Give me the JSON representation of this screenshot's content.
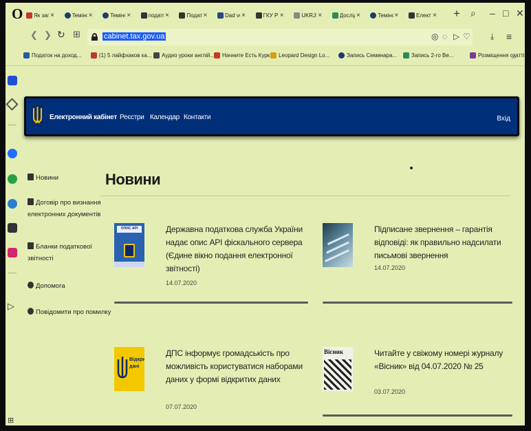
{
  "browser": {
    "logo": "O",
    "tabs": [
      {
        "label": "Як запис",
        "icon": "red-square-icon",
        "color": "#c0392b"
      },
      {
        "label": "Teмінол",
        "icon": "question-circle-icon",
        "color": "#1f3b6b"
      },
      {
        "label": "Teмінол",
        "icon": "question-circle-icon",
        "color": "#1f3b6b"
      },
      {
        "label": "податк",
        "icon": "google-icon",
        "color": "#333333"
      },
      {
        "label": "Подат",
        "icon": "ukraine-trident-icon",
        "color": "#333333"
      },
      {
        "label": "Dad ve",
        "icon": "book-icon",
        "color": "#2a4a7a"
      },
      {
        "label": "ГКУ Р",
        "icon": "ukraine-trident-icon",
        "color": "#333333"
      },
      {
        "label": "UKRJNE",
        "icon": "dash-icon",
        "color": "#888888"
      },
      {
        "label": "Досліді",
        "icon": "drive-icon",
        "color": "#2e8b57"
      },
      {
        "label": "Teмінол",
        "icon": "question-circle-icon",
        "color": "#1f3b6b"
      },
      {
        "label": "Електрс",
        "icon": "document-icon",
        "color": "#333333"
      }
    ],
    "url": "cabinet.tax.gov.ua",
    "bookmarks": [
      {
        "label": "Податок на доход...",
        "icon": "tax-doc-icon",
        "color": "#2a5a9a"
      },
      {
        "label": "(1) 5 лайфхаков ка...",
        "icon": "youtube-icon",
        "color": "#c0392b"
      },
      {
        "label": "Аудио уроки англій...",
        "icon": "audio-icon",
        "color": "#444444"
      },
      {
        "label": "Начните Есть Курк...",
        "icon": "youtube-icon",
        "color": "#c0392b"
      },
      {
        "label": "Leopard Design Lo...",
        "icon": "leopard-icon",
        "color": "#d4a017"
      },
      {
        "label": "Запись Семинара...",
        "icon": "circle-icon",
        "color": "#1f3b6b"
      },
      {
        "label": "Запись 2-го Ве...",
        "icon": "drive-icon",
        "color": "#2e8b57"
      },
      {
        "label": "Розміщення статті...",
        "icon": "pen-icon",
        "color": "#7a3b9a"
      }
    ]
  },
  "site": {
    "nav": [
      "Електронний кабінет",
      "Реєстри",
      "Календар",
      "Контакти"
    ],
    "login": "Вхід",
    "sidebar": [
      {
        "label": "Новини",
        "icon": "newspaper-icon"
      },
      {
        "label": "Договір про визнання електронних документів",
        "icon": "contract-icon"
      },
      {
        "label": "Бланки податкової звітності",
        "icon": "forms-icon"
      },
      {
        "label": "Допомога",
        "icon": "help-icon"
      },
      {
        "label": "Повідомити про помилку",
        "icon": "report-icon"
      }
    ],
    "page_title": "Новини",
    "news": [
      {
        "headline": "Державна податкова служба України надає опис API фіскального сервера (Єдине вікно подання електронної звітності)",
        "date": "14.07.2020",
        "thumb_text": "ОПИС API"
      },
      {
        "headline": "Підписане звернення – гарантія відповіді: як правильно надсилати письмові звернення",
        "date": "14.07.2020",
        "thumb_text": ""
      },
      {
        "headline": "ДПС інформує громадськість про можливість користуватися наборами даних у формі відкритих даних",
        "date": "07.07.2020",
        "thumb_text": "Відкриті дані"
      },
      {
        "headline": "Читайте у свіжому номері журналу «Вісник» від 04.07.2020 № 25",
        "date": "03.07.2020",
        "thumb_text": "Вісник"
      }
    ]
  }
}
